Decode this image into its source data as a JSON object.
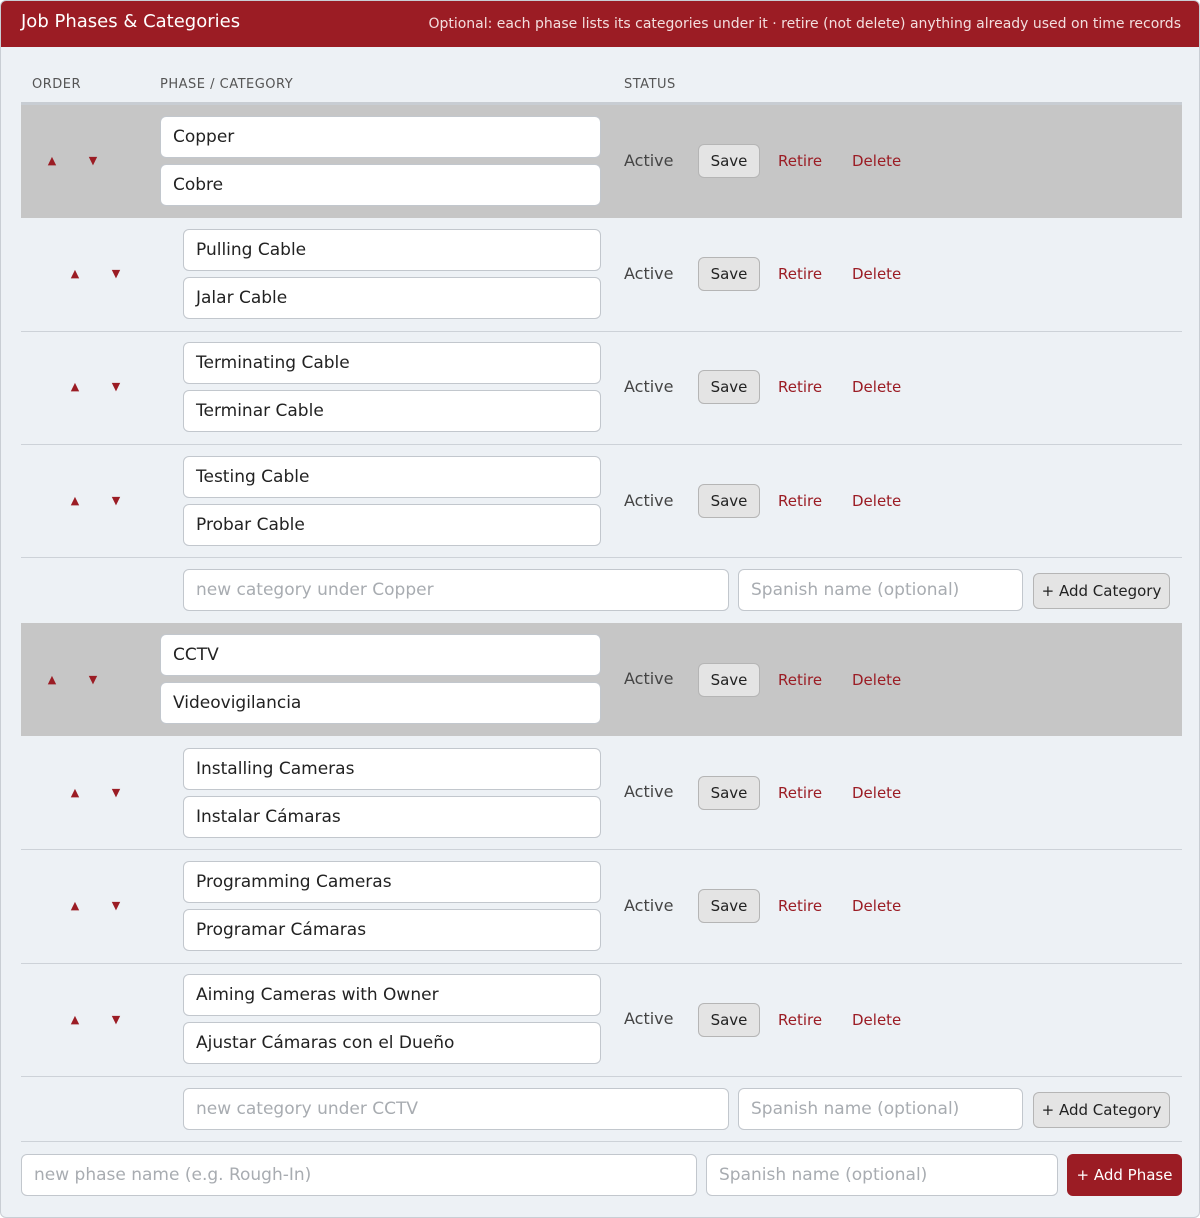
{
  "header": {
    "title": "Job Phases & Categories",
    "subtitle": "Optional: each phase lists its categories under it · retire (not delete) anything already used on time records"
  },
  "columns": {
    "order": "ORDER",
    "phase_category": "PHASE / CATEGORY",
    "status": "STATUS"
  },
  "arrows": {
    "up": "▲",
    "down": "▼"
  },
  "actions": {
    "save": "Save",
    "retire": "Retire",
    "delete": "Delete"
  },
  "phases": [
    {
      "name": "Copper",
      "spanish": "Cobre",
      "status": "Active",
      "categories": [
        {
          "name": "Pulling Cable",
          "spanish": "Jalar Cable",
          "status": "Active"
        },
        {
          "name": "Terminating Cable",
          "spanish": "Terminar Cable",
          "status": "Active"
        },
        {
          "name": "Testing Cable",
          "spanish": "Probar Cable",
          "status": "Active"
        }
      ],
      "new_category_placeholder": "new category under Copper",
      "spanish_placeholder": "Spanish name (optional)",
      "add_category_label": "+ Add Category"
    },
    {
      "name": "CCTV",
      "spanish": "Videovigilancia",
      "status": "Active",
      "categories": [
        {
          "name": "Installing Cameras",
          "spanish": "Instalar Cámaras",
          "status": "Active"
        },
        {
          "name": "Programming Cameras",
          "spanish": "Programar Cámaras",
          "status": "Active"
        },
        {
          "name": "Aiming Cameras with Owner",
          "spanish": "Ajustar Cámaras con el Dueño",
          "status": "Active"
        }
      ],
      "new_category_placeholder": "new category under CCTV",
      "spanish_placeholder": "Spanish name (optional)",
      "add_category_label": "+ Add Category"
    }
  ],
  "add_phase": {
    "name_placeholder": "new phase name (e.g. Rough-In)",
    "spanish_placeholder": "Spanish name (optional)",
    "button_label": "+ Add Phase"
  },
  "colors": {
    "accent": "#9b1c24",
    "phase_row": "#c6c6c6",
    "background": "#edf1f5"
  }
}
